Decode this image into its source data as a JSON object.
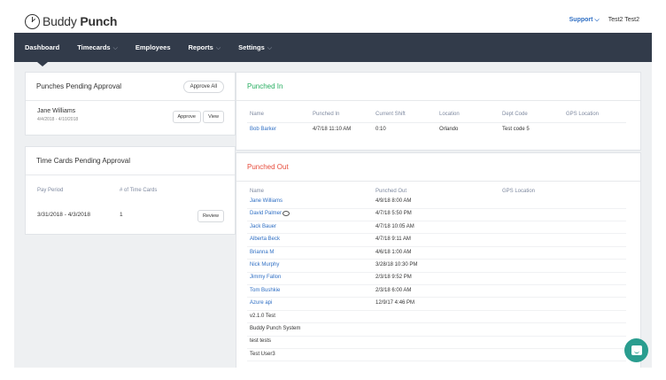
{
  "topbar": {
    "logo_light": "Buddy",
    "logo_bold": "Punch",
    "support": "Support",
    "support_chev": "⌵",
    "user": "Test2 Test2"
  },
  "nav": {
    "items": [
      {
        "label": "Dashboard",
        "chev": ""
      },
      {
        "label": "Timecards",
        "chev": "⌵"
      },
      {
        "label": "Employees",
        "chev": ""
      },
      {
        "label": "Reports",
        "chev": "⌵"
      },
      {
        "label": "Settings",
        "chev": "⌵"
      }
    ]
  },
  "punches_pending": {
    "title": "Punches Pending Approval",
    "approve_all": "Approve All",
    "entry": {
      "name": "Jane Williams",
      "dates": "4/4/2018 - 4/10/2018",
      "approve": "Approve",
      "view": "View"
    }
  },
  "timecards_pending": {
    "title": "Time Cards Pending Approval",
    "col_period": "Pay Period",
    "col_count": "# of Time Cards",
    "row": {
      "period": "3/31/2018 - 4/3/2018",
      "count": "1",
      "review": "Review"
    }
  },
  "punched_in": {
    "title": "Punched In",
    "title_color": "#27ae60",
    "headers": [
      "Name",
      "Punched In",
      "Current Shift",
      "Location",
      "Dept Code",
      "GPS Location"
    ],
    "row": {
      "name": "Bob Barker",
      "punched_in": "4/7/18 11:10 AM",
      "shift": "0:10",
      "location": "Orlando",
      "dept": "Test code 5"
    }
  },
  "punched_out": {
    "title": "Punched Out",
    "title_color": "#e74c3c",
    "headers": [
      "Name",
      "Punched Out",
      "GPS Location"
    ],
    "rows": [
      {
        "name": "Jane Williams",
        "time": "4/9/18 8:00 AM",
        "link": true
      },
      {
        "name": "David Palmer",
        "time": "4/7/18 5:50 PM",
        "link": true
      },
      {
        "name": "Jack Bauer",
        "time": "4/7/18 10:05 AM",
        "link": true
      },
      {
        "name": "Alberta Beck",
        "time": "4/7/18 9:11 AM",
        "link": true
      },
      {
        "name": "Brianna M",
        "time": "4/6/18 1:00 AM",
        "link": true
      },
      {
        "name": "Nick Murphy",
        "time": "3/28/18 10:30 PM",
        "link": true
      },
      {
        "name": "Jimmy Fallon",
        "time": "2/3/18 9:52 PM",
        "link": true
      },
      {
        "name": "Tom Bushkie",
        "time": "2/3/18 6:00 AM",
        "link": true
      },
      {
        "name": "Azure api",
        "time": "12/9/17 4:46 PM",
        "link": true
      },
      {
        "name": "v2.1.0 Test",
        "time": "",
        "link": false
      },
      {
        "name": "Buddy Punch System",
        "time": "",
        "link": false
      },
      {
        "name": "test tests",
        "time": "",
        "link": false
      },
      {
        "name": "Test User3",
        "time": "",
        "link": false
      }
    ]
  },
  "icons": {
    "chat": "chat-bubble-icon",
    "comment": "comment-icon"
  }
}
